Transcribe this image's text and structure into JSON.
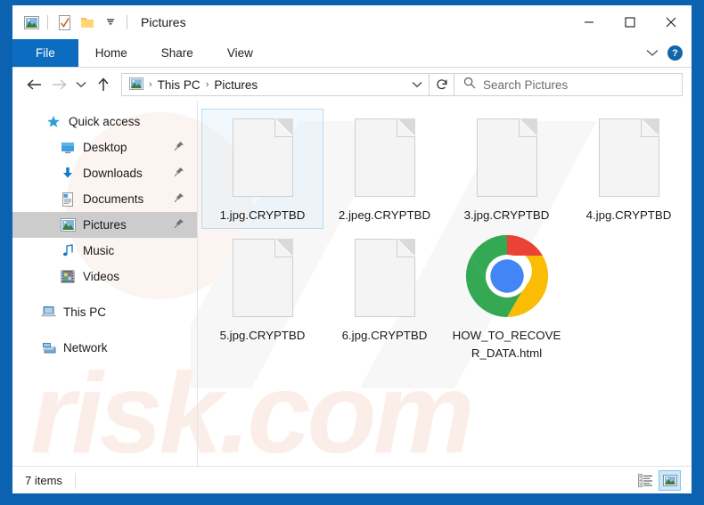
{
  "window": {
    "title": "Pictures",
    "quick_access_toolbar": [
      {
        "name": "pictures-folder-icon",
        "label": "Pictures"
      },
      {
        "name": "properties-icon",
        "label": "Properties"
      },
      {
        "name": "new-folder-icon",
        "label": "New folder"
      },
      {
        "name": "customize-dropdown-icon",
        "label": "Customize Quick Access Toolbar"
      }
    ],
    "controls": {
      "minimize": "—",
      "maximize": "☐",
      "close": "✕"
    }
  },
  "ribbon": {
    "tabs": [
      {
        "label": "File",
        "active": true
      },
      {
        "label": "Home",
        "active": false
      },
      {
        "label": "Share",
        "active": false
      },
      {
        "label": "View",
        "active": false
      }
    ],
    "expand_label": "⌄",
    "help_label": "?"
  },
  "address": {
    "back_label": "←",
    "forward_label": "→",
    "recent_label": "⌄",
    "up_label": "↑",
    "breadcrumb": [
      "This PC",
      "Pictures"
    ],
    "breadcrumb_separator": "›",
    "dropdown_label": "⌄",
    "refresh_label": "↻"
  },
  "search": {
    "placeholder": "Search Pictures",
    "value": "",
    "icon": "search-icon"
  },
  "sidebar": {
    "groups": [
      {
        "name": "quick-access",
        "label": "Quick access",
        "icon": "star-icon",
        "items": [
          {
            "label": "Desktop",
            "icon": "desktop-icon",
            "pinned": true,
            "selected": false
          },
          {
            "label": "Downloads",
            "icon": "download-icon",
            "pinned": true,
            "selected": false
          },
          {
            "label": "Documents",
            "icon": "document-icon",
            "pinned": true,
            "selected": false
          },
          {
            "label": "Pictures",
            "icon": "pictures-icon",
            "pinned": true,
            "selected": true
          },
          {
            "label": "Music",
            "icon": "music-icon",
            "pinned": false,
            "selected": false
          },
          {
            "label": "Videos",
            "icon": "video-icon",
            "pinned": false,
            "selected": false
          }
        ]
      }
    ],
    "roots": [
      {
        "label": "This PC",
        "icon": "computer-icon"
      },
      {
        "label": "Network",
        "icon": "network-icon"
      }
    ],
    "pin_glyph": "📌"
  },
  "files": [
    {
      "name": "1.jpg.CRYPTBD",
      "icon": "blank-document-icon",
      "selected": true
    },
    {
      "name": "2.jpeg.CRYPTBD",
      "icon": "blank-document-icon",
      "selected": false
    },
    {
      "name": "3.jpg.CRYPTBD",
      "icon": "blank-document-icon",
      "selected": false
    },
    {
      "name": "4.jpg.CRYPTBD",
      "icon": "blank-document-icon",
      "selected": false
    },
    {
      "name": "5.jpg.CRYPTBD",
      "icon": "blank-document-icon",
      "selected": false
    },
    {
      "name": "6.jpg.CRYPTBD",
      "icon": "blank-document-icon",
      "selected": false
    },
    {
      "name": "HOW_TO_RECOVER_DATA.html",
      "icon": "chrome-icon",
      "selected": false
    }
  ],
  "status": {
    "item_count": "7 items",
    "views": [
      {
        "name": "details-view",
        "active": false
      },
      {
        "name": "large-icons-view",
        "active": true
      }
    ]
  },
  "watermark": {
    "text": "risk.com"
  },
  "colors": {
    "accent": "#0c6cbf",
    "frame": "#0a62b0",
    "selection_border": "#b4dbf5",
    "sidebar_selected": "#cccccc",
    "chrome_red": "#ea4335",
    "chrome_green": "#34a853",
    "chrome_yellow": "#fbbc05",
    "chrome_blue": "#4285f4"
  }
}
